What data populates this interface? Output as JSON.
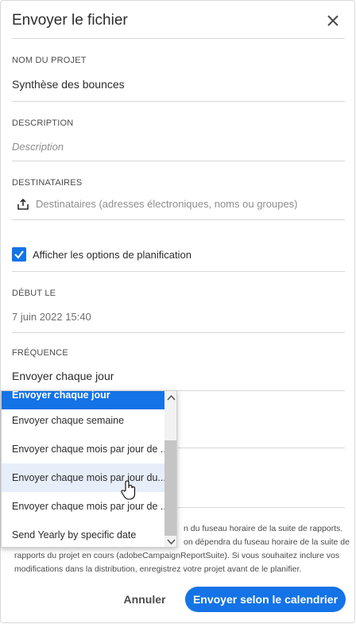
{
  "dialog": {
    "title": "Envoyer le fichier"
  },
  "project": {
    "label": "NOM DU PROJET",
    "value": "Synthèse des bounces"
  },
  "description": {
    "label": "DESCRIPTION",
    "placeholder": "Description"
  },
  "recipients": {
    "label": "DESTINATAIRES",
    "placeholder": "Destinataires (adresses électroniques, noms ou groupes)"
  },
  "schedule_toggle": {
    "label": "Afficher les options de planification",
    "checked": true
  },
  "start": {
    "label": "DÉBUT LE",
    "value": "7 juin 2022 15:40"
  },
  "frequency": {
    "label": "FRÉQUENCE",
    "value": "Envoyer chaque jour",
    "options": [
      "Envoyer chaque jour",
      "Envoyer chaque semaine",
      "Envoyer chaque mois par jour de ...",
      "Envoyer chaque mois par jour du...",
      "Envoyer chaque mois par jour de ...",
      "Send Yearly by specific date"
    ]
  },
  "note": {
    "line1": "n du fuseau horaire de la suite de rapports.",
    "line2": "on dépendra du fuseau horaire de la suite de",
    "line3": "rapports du projet en cours (adobeCampaignReportSuite). Si vous souhaitez inclure vos",
    "line4": "modifications dans la distribution, enregistrez votre projet avant de le planifier."
  },
  "actions": {
    "cancel": "Annuler",
    "submit": "Envoyer selon le calendrier"
  },
  "colors": {
    "accent": "#1473e6"
  }
}
